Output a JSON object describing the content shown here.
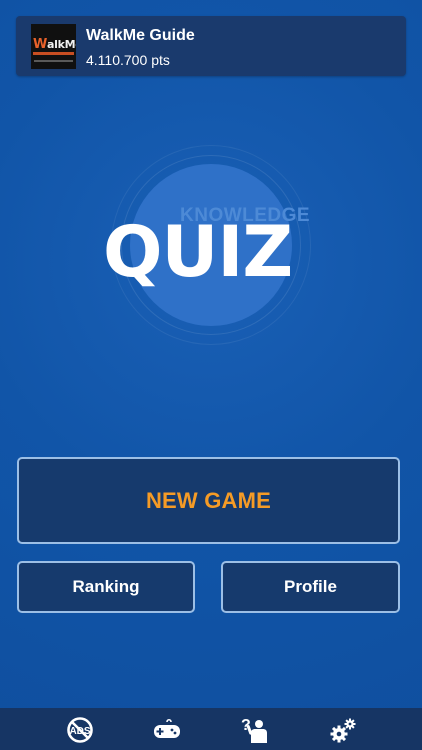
{
  "profile": {
    "name": "WalkMe Guide",
    "points": "4.110.700",
    "points_unit": "pts",
    "avatar_logo_lead": "W",
    "avatar_logo_rest": "alkMe"
  },
  "logo": {
    "knowledge": "KNOWLEDGE",
    "quiz": "QUIZ"
  },
  "menu": {
    "new_game": "NEW GAME",
    "ranking": "Ranking",
    "profile": "Profile"
  },
  "bottom_tabs": [
    {
      "icon": "no-ads-icon"
    },
    {
      "icon": "gamepad-icon"
    },
    {
      "icon": "question-person-icon"
    },
    {
      "icon": "settings-gears-icon"
    }
  ],
  "colors": {
    "background": "#1155a8",
    "card": "#163a6d",
    "button_border": "#9cbfe6",
    "accent_orange": "#f59b26",
    "bottom_bar": "#163564"
  }
}
